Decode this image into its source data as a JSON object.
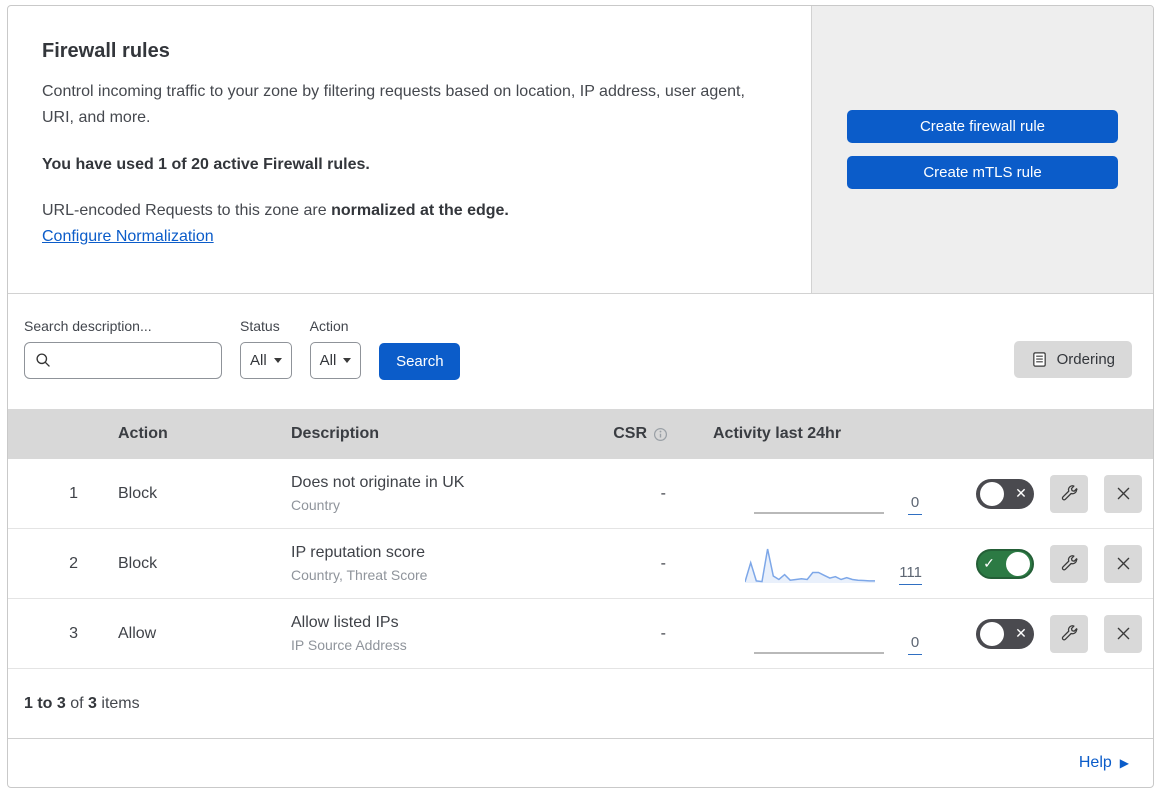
{
  "intro": {
    "title": "Firewall rules",
    "description": "Control incoming traffic to your zone by filtering requests based on location, IP address, user agent, URI, and more.",
    "usage": "You have used 1 of 20 active Firewall rules.",
    "normalization_text": "URL-encoded Requests to this zone are ",
    "normalization_bold": "normalized at the edge.",
    "normalization_link": "Configure Normalization"
  },
  "actions": {
    "create_firewall_rule": "Create firewall rule",
    "create_mtls_rule": "Create mTLS rule"
  },
  "filters": {
    "search_label": "Search description...",
    "search_value": "",
    "status_label": "Status",
    "status_value": "All",
    "action_label": "Action",
    "action_value": "All",
    "search_button": "Search",
    "ordering_button": "Ordering"
  },
  "table": {
    "columns": {
      "action": "Action",
      "description": "Description",
      "csr": "CSR",
      "activity": "Activity last 24hr"
    },
    "rows": [
      {
        "number": "1",
        "action": "Block",
        "description": "Does not originate in UK",
        "fields": "Country",
        "csr": "-",
        "activity_count": "0",
        "enabled": false,
        "sparkline": []
      },
      {
        "number": "2",
        "action": "Block",
        "description": "IP reputation score",
        "fields": "Country, Threat Score",
        "csr": "-",
        "activity_count": "111",
        "enabled": true,
        "sparkline": [
          3,
          58,
          6,
          4,
          97,
          20,
          10,
          24,
          8,
          10,
          12,
          10,
          30,
          30,
          22,
          14,
          18,
          10,
          15,
          10,
          8,
          7,
          6,
          6
        ]
      },
      {
        "number": "3",
        "action": "Allow",
        "description": "Allow listed IPs",
        "fields": "IP Source Address",
        "csr": "-",
        "activity_count": "0",
        "enabled": false,
        "sparkline": []
      }
    ],
    "footer": {
      "range": "1 to 3",
      "of": " of ",
      "total": "3",
      "items": " items"
    }
  },
  "help": {
    "label": "Help"
  },
  "colors": {
    "accent": "#0b5cc9",
    "panel_gray": "#eeeeee",
    "table_header_gray": "#d8d8d8",
    "icon_button_gray": "#d9d9d9",
    "toggle_on_green": "#2c7a44",
    "toggle_off_gray": "#4a4a4f",
    "sparkline_stroke": "#7da7e8",
    "sparkline_fill": "#e9f0fb",
    "count_underline": "#2f6fc2"
  }
}
